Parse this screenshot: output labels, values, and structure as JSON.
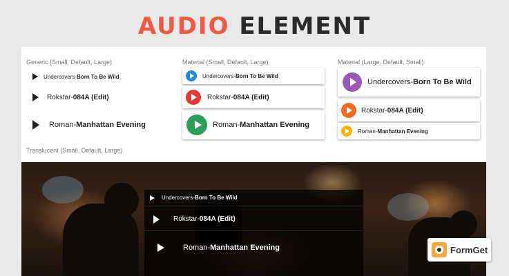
{
  "header": {
    "title_accent": "AUDIO",
    "title_main": "ELEMENT"
  },
  "colors": {
    "accent": "#ef5a43",
    "blue": "#1e88e5",
    "red": "#e53935",
    "green": "#2e9e5b",
    "purple": "#9b59b6",
    "orange": "#f26a21",
    "yellow": "#f5b800"
  },
  "sections": {
    "generic": "Generic (Small, Default, Large)",
    "material_small": "Material (Small, Default, Large)",
    "material_large": "Material (Large, Default, Small)",
    "translucent": "Translucent (Small, Default, Large)"
  },
  "tracks": [
    {
      "artist": "Undercovers",
      "separator": " - ",
      "title": "Born To Be Wild"
    },
    {
      "artist": "Rokstar",
      "separator": " - ",
      "title": "084A (Edit)"
    },
    {
      "artist": "Roman",
      "separator": " - ",
      "title": "Manhattan Evening"
    }
  ],
  "logo": {
    "text": "FormGet",
    "icon": "formget-owl-icon"
  }
}
